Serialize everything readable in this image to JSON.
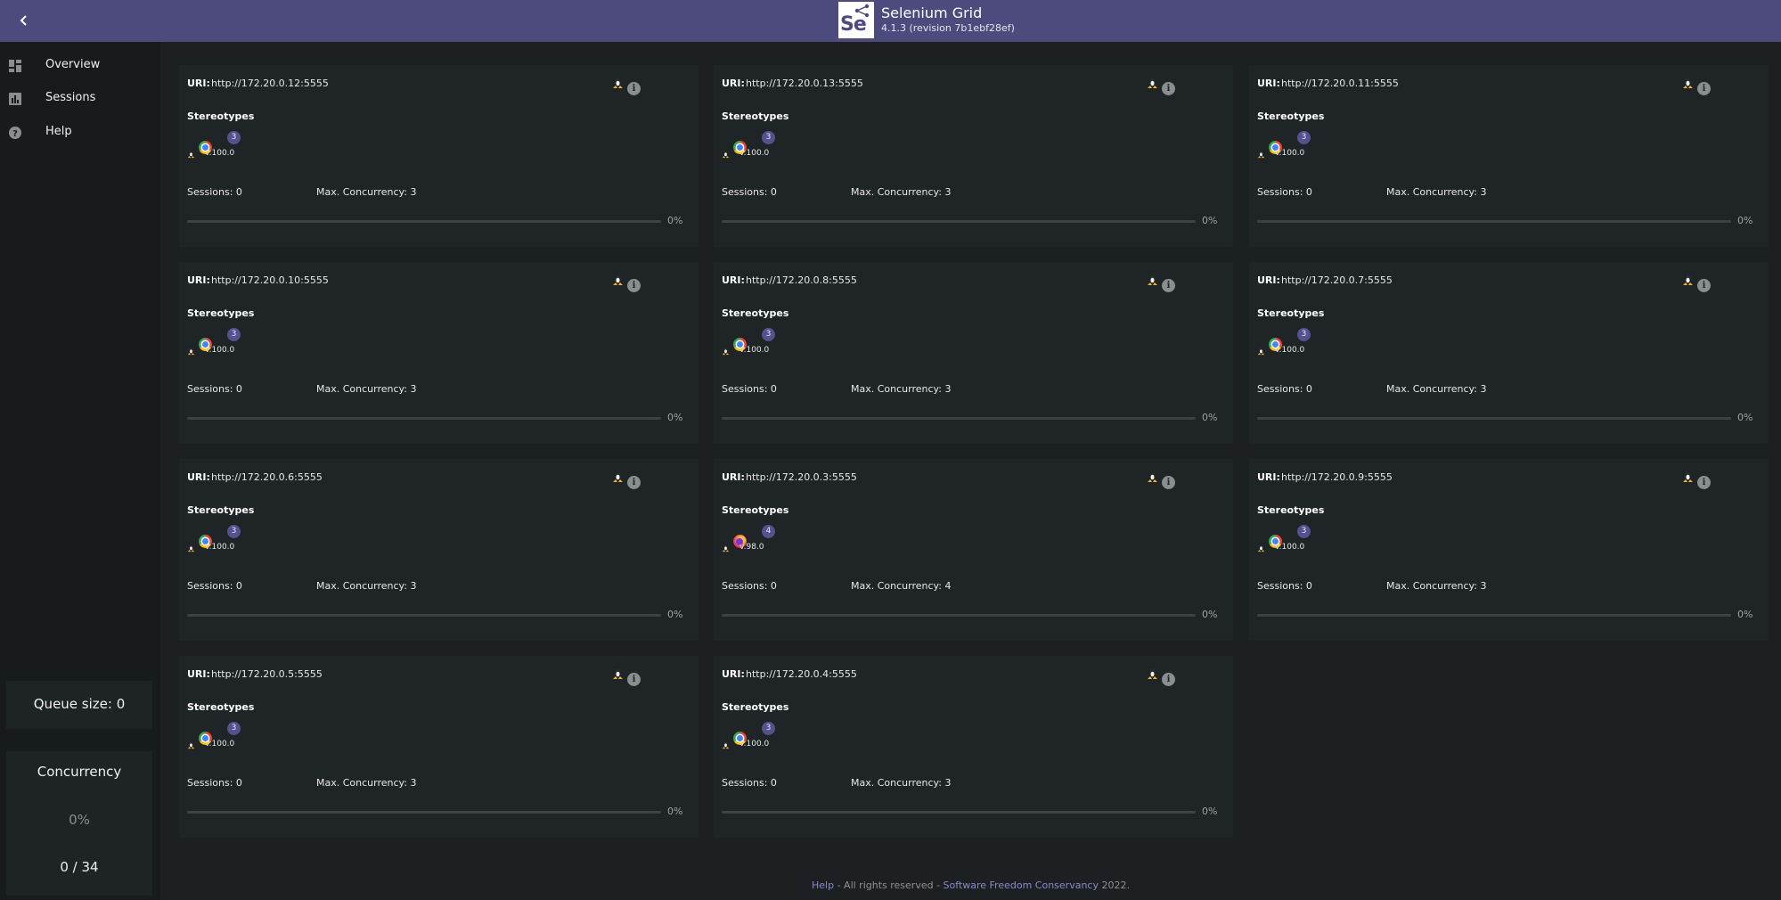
{
  "header": {
    "title": "Selenium Grid",
    "version": "4.1.3 (revision 7b1ebf28ef)",
    "logo_text": "Se",
    "back_icon": "chevron-left-icon",
    "background": "#4d4b7e"
  },
  "sidebar": {
    "items": [
      {
        "label": "Overview",
        "icon": "dashboard-icon"
      },
      {
        "label": "Sessions",
        "icon": "bar-chart-icon"
      },
      {
        "label": "Help",
        "icon": "help-circle-icon"
      }
    ]
  },
  "queue": {
    "label": "Queue size: 0"
  },
  "concurrency": {
    "title": "Concurrency",
    "percent": "0%",
    "count": "0 / 34"
  },
  "node_labels": {
    "uri": "URI:",
    "stereotypes": "Stereotypes",
    "info_icon_glyph": "i"
  },
  "nodes": [
    {
      "uri": "http://172.20.0.12:5555",
      "browser": "chrome",
      "version": "v.100.0",
      "slots": "3",
      "sessions": "Sessions: 0",
      "max": "Max. Concurrency: 3",
      "load": 0,
      "load_label": "0%"
    },
    {
      "uri": "http://172.20.0.13:5555",
      "browser": "chrome",
      "version": "v.100.0",
      "slots": "3",
      "sessions": "Sessions: 0",
      "max": "Max. Concurrency: 3",
      "load": 0,
      "load_label": "0%"
    },
    {
      "uri": "http://172.20.0.11:5555",
      "browser": "chrome",
      "version": "v.100.0",
      "slots": "3",
      "sessions": "Sessions: 0",
      "max": "Max. Concurrency: 3",
      "load": 0,
      "load_label": "0%"
    },
    {
      "uri": "http://172.20.0.10:5555",
      "browser": "chrome",
      "version": "v.100.0",
      "slots": "3",
      "sessions": "Sessions: 0",
      "max": "Max. Concurrency: 3",
      "load": 0,
      "load_label": "0%"
    },
    {
      "uri": "http://172.20.0.8:5555",
      "browser": "chrome",
      "version": "v.100.0",
      "slots": "3",
      "sessions": "Sessions: 0",
      "max": "Max. Concurrency: 3",
      "load": 0,
      "load_label": "0%"
    },
    {
      "uri": "http://172.20.0.7:5555",
      "browser": "chrome",
      "version": "v.100.0",
      "slots": "3",
      "sessions": "Sessions: 0",
      "max": "Max. Concurrency: 3",
      "load": 0,
      "load_label": "0%"
    },
    {
      "uri": "http://172.20.0.6:5555",
      "browser": "chrome",
      "version": "v.100.0",
      "slots": "3",
      "sessions": "Sessions: 0",
      "max": "Max. Concurrency: 3",
      "load": 0,
      "load_label": "0%"
    },
    {
      "uri": "http://172.20.0.3:5555",
      "browser": "firefox",
      "version": "v.98.0",
      "slots": "4",
      "sessions": "Sessions: 0",
      "max": "Max. Concurrency: 4",
      "load": 0,
      "load_label": "0%"
    },
    {
      "uri": "http://172.20.0.9:5555",
      "browser": "chrome",
      "version": "v.100.0",
      "slots": "3",
      "sessions": "Sessions: 0",
      "max": "Max. Concurrency: 3",
      "load": 0,
      "load_label": "0%"
    },
    {
      "uri": "http://172.20.0.5:5555",
      "browser": "chrome",
      "version": "v.100.0",
      "slots": "3",
      "sessions": "Sessions: 0",
      "max": "Max. Concurrency: 3",
      "load": 0,
      "load_label": "0%"
    },
    {
      "uri": "http://172.20.0.4:5555",
      "browser": "chrome",
      "version": "v.100.0",
      "slots": "3",
      "sessions": "Sessions: 0",
      "max": "Max. Concurrency: 3",
      "load": 0,
      "load_label": "0%"
    }
  ],
  "footer": {
    "help": "Help",
    "middle": " - All rights reserved - ",
    "org": "Software Freedom Conservancy",
    "year": " 2022."
  }
}
